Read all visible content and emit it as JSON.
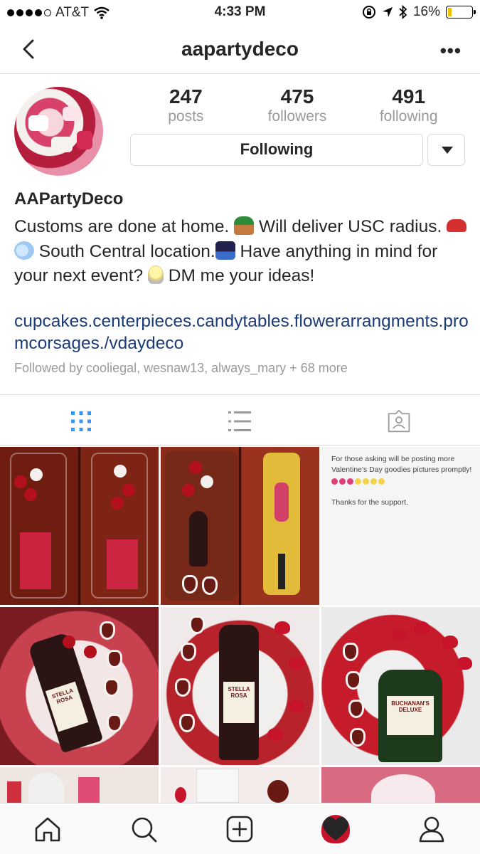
{
  "status_bar": {
    "carrier": "AT&T",
    "time": "4:33 PM",
    "battery": "16%"
  },
  "header": {
    "username": "aapartydeco",
    "more_label": "•••"
  },
  "profile": {
    "stats": [
      {
        "value": "247",
        "label": "posts"
      },
      {
        "value": "475",
        "label": "followers"
      },
      {
        "value": "491",
        "label": "following"
      }
    ],
    "follow_button_label": "Following",
    "name": "AAPartyDeco",
    "bio": {
      "part1": "Customs are done at home. ",
      "part2": " Will deliver USC radius. ",
      "part3": " ",
      "part4": " South Central location.",
      "part5": " Have anything in mind for your next event? ",
      "part6": "  DM me your ideas!"
    },
    "link": "cupcakes.centerpieces.candytables.flowerarrangments.promcorsages./vdaydeco",
    "followed_by": "Followed by cooliegal, wesnaw13, always_mary + 68 more"
  },
  "grid_posts": {
    "note_line1": "For those asking will be posting more Valentine's Day goodies pictures promptly!",
    "note_line2": "Thanks for the support.",
    "wine_label": "STELLA ROSA",
    "whisky_label": "BUCHANAN'S DELUXE"
  },
  "accent_color": "#3897f0",
  "link_color": "#1c3c78",
  "icons": {
    "back": "chevron-left-icon",
    "grid": "grid-icon",
    "list": "list-icon",
    "tagged": "tagged-photos-icon",
    "home": "home-icon",
    "search": "search-icon",
    "add": "add-post-icon",
    "activity": "heart-icon",
    "profile": "profile-icon"
  }
}
